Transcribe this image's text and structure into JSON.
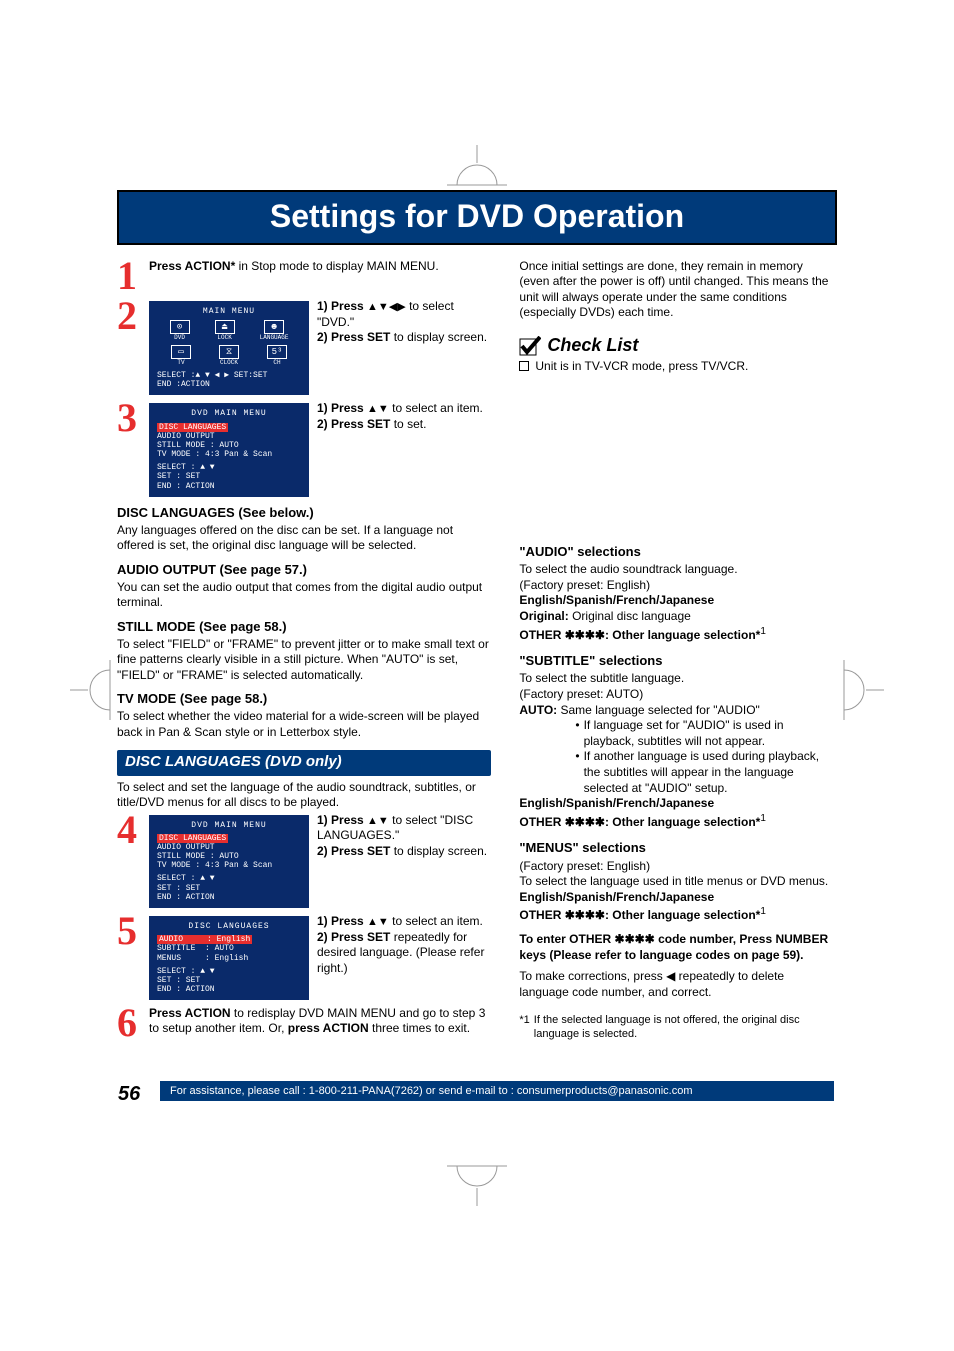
{
  "title": "Settings for DVD Operation",
  "page_number": "56",
  "footer": "For assistance, please call : 1-800-211-PANA(7262) or send e-mail to : consumerproducts@panasonic.com",
  "steps": {
    "s1": {
      "line1_pre": "Press ACTION*",
      "line1_post": " in Stop mode to display MAIN MENU."
    },
    "s2": {
      "osd_title": "MAIN  MENU",
      "icons": [
        {
          "label": "DVD",
          "sym": "⊙"
        },
        {
          "label": "LOCK",
          "sym": "⏏"
        },
        {
          "label": "LANGUAGE",
          "sym": "☻"
        },
        {
          "label": "TV",
          "sym": "▭"
        },
        {
          "label": "CLOCK",
          "sym": "⧖"
        },
        {
          "label": "CH",
          "sym": "5³"
        }
      ],
      "osd_footer_a": "SELECT :▲ ▼ ◀ ▶   SET:SET",
      "osd_footer_b": "END    :ACTION",
      "i1_b": "Press ",
      "i1_arrows": "▲▼◀▶",
      "i1_t": " to select \"DVD.\"",
      "i2_b": "Press SET",
      "i2_t": " to display screen."
    },
    "s3": {
      "osd_title": "DVD  MAIN  MENU",
      "rows": [
        {
          "k": "DISC  LANGUAGES",
          "v": "",
          "hl": true
        },
        {
          "k": "AUDIO  OUTPUT",
          "v": ""
        },
        {
          "k": "STILL  MODE",
          "v": ": AUTO"
        },
        {
          "k": "TV  MODE",
          "v": ": 4:3 Pan & Scan"
        }
      ],
      "osd_footer_a": "SELECT       : ▲ ▼",
      "osd_footer_b": "SET          : SET",
      "osd_footer_c": "END          : ACTION",
      "i1_b": "Press ",
      "i1_arrows": "▲▼",
      "i1_t": " to select an item.",
      "i2_b": "Press SET",
      "i2_t": " to set."
    },
    "s4": {
      "osd_title": "DVD  MAIN  MENU",
      "rows": [
        {
          "k": "DISC  LANGUAGES",
          "v": "",
          "hl": true
        },
        {
          "k": "AUDIO  OUTPUT",
          "v": ""
        },
        {
          "k": "STILL  MODE",
          "v": ": AUTO"
        },
        {
          "k": "TV  MODE",
          "v": ": 4:3 Pan & Scan"
        }
      ],
      "osd_footer_a": "SELECT       : ▲ ▼",
      "osd_footer_b": "SET          : SET",
      "osd_footer_c": "END          : ACTION",
      "i1_b": "Press ",
      "i1_arrows": "▲▼",
      "i1_t": " to select \"DISC LANGUAGES.\"",
      "i2_b": "Press SET",
      "i2_t": " to display screen."
    },
    "s5": {
      "osd_title": "DISC  LANGUAGES",
      "rows": [
        {
          "k": "AUDIO",
          "v": ": English",
          "hl": true
        },
        {
          "k": "SUBTITLE",
          "v": ": AUTO"
        },
        {
          "k": "MENUS",
          "v": ": English"
        }
      ],
      "osd_footer_a": "SELECT       : ▲ ▼",
      "osd_footer_b": "SET          : SET",
      "osd_footer_c": "END          : ACTION",
      "i1_b": "Press ",
      "i1_arrows": "▲▼",
      "i1_t": " to select an item.",
      "i2_b": "Press SET",
      "i2_t": " repeatedly for desired language. (Please refer right.)"
    },
    "s6": {
      "a_b": "Press ACTION",
      "a_t": " to redisplay DVD MAIN MENU and go to step 3 to setup another item. Or, ",
      "b_b": "press ACTION",
      "b_t": " three times to exit."
    }
  },
  "left_sections": {
    "disc_h": "DISC LANGUAGES (See below.)",
    "disc_p": "Any languages offered on the disc can be set. If a language not offered is set, the original disc language will be selected.",
    "audio_h": "AUDIO OUTPUT (See page 57.)",
    "audio_p": "You can set the audio output that comes from the digital audio output terminal.",
    "still_h": "STILL MODE (See page 58.)",
    "still_p": "To select \"FIELD\" or \"FRAME\" to prevent jitter or to make small text or fine patterns clearly visible in a still picture. When \"AUTO\" is set, \"FIELD\" or \"FRAME\" is selected automatically.",
    "tv_h": "TV MODE (See page 58.)",
    "tv_p": "To select whether the video material for a wide-screen will be played back in Pan & Scan style or in Letterbox style."
  },
  "sub_banner": "DISC LANGUAGES (DVD only)",
  "sub_banner_p": "To select and set the language of the audio soundtrack, subtitles, or title/DVD menus for all discs to be played.",
  "right": {
    "intro": "Once initial settings are done, they remain in memory (even after the power is off) until changed. This means the unit will always operate under the same conditions (especially DVDs) each time.",
    "check_title": "Check List",
    "check_item": "Unit is in TV-VCR mode, press TV/VCR.",
    "audio_h": "\"AUDIO\" selections",
    "audio_p1": "To select the audio soundtrack language.",
    "audio_p2": "(Factory preset: English)",
    "audio_b1": "English/Spanish/French/Japanese",
    "audio_b2": "Original:",
    "audio_b2_t": " Original disc language",
    "audio_b3": "OTHER ",
    "audio_b3_t": ": Other language selection*",
    "audio_b3_s": "1",
    "sub_h": "\"SUBTITLE\" selections",
    "sub_p1": "To select the subtitle language.",
    "sub_p2": "(Factory preset: AUTO)",
    "sub_auto_b": "AUTO:",
    "sub_auto_t": "  Same language selected for \"AUDIO\"",
    "sub_b1": "If language set for \"AUDIO\" is used in playback, subtitles will not appear.",
    "sub_b2": "If another language is used during playback, the subtitles will appear in the language selected at \"AUDIO\" setup.",
    "sub_l": "English/Spanish/French/Japanese",
    "sub_o": "OTHER ",
    "sub_o_t": ": Other language selection*",
    "sub_o_s": "1",
    "menu_h": "\"MENUS\" selections",
    "menu_p1": "(Factory preset: English)",
    "menu_p2": "To select the language used in title menus or DVD menus.",
    "menu_l": "English/Spanish/French/Japanese",
    "menu_o": "OTHER ",
    "menu_o_t": ": Other language selection*",
    "menu_o_s": "1",
    "enter_1": "To enter OTHER ",
    "enter_2": " code number, Press NUMBER keys (Please refer to language codes on page 59).",
    "corr_1": "To make corrections, press ",
    "corr_2": " repeatedly to delete language code number, and correct.",
    "fn_sup": "*1",
    "fn_t": "If the selected language is not offered, the original disc language is selected."
  }
}
